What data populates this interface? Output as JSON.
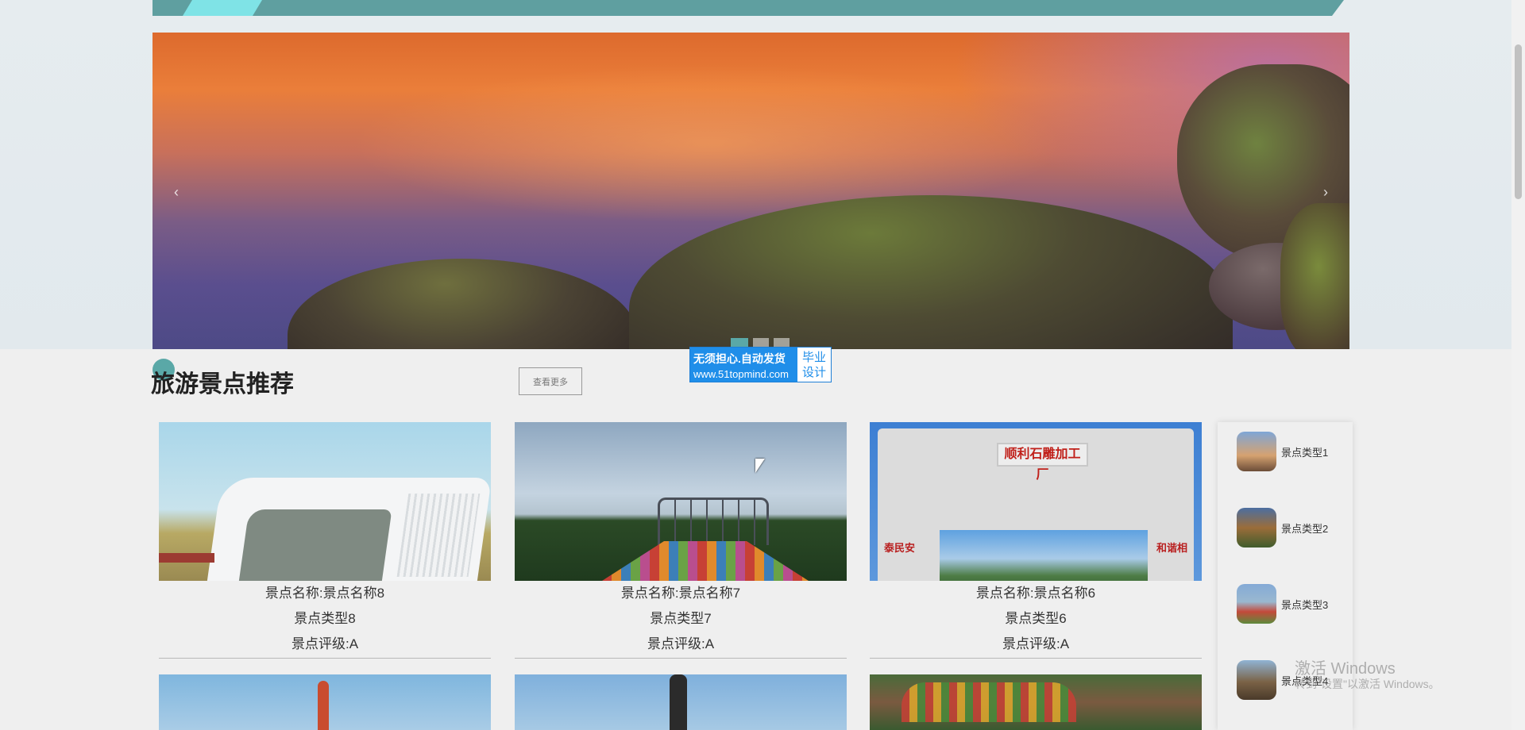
{
  "banner": {
    "prev_glyph": "‹",
    "next_glyph": "›",
    "slide_count": 3,
    "active_slide": 1
  },
  "badge": {
    "line1": "无须担心.自动发货",
    "line2": "www.51topmind.com",
    "right_line1": "毕业",
    "right_line2": "设计"
  },
  "section": {
    "title": "旅游景点推荐",
    "more_label": "查看更多"
  },
  "cards": [
    {
      "name": "景点名称:景点名称8",
      "type": "景点类型8",
      "rating": "景点评级:A"
    },
    {
      "name": "景点名称:景点名称7",
      "type": "景点类型7",
      "rating": "景点评级:A"
    },
    {
      "name": "景点名称:景点名称6",
      "type": "景点类型6",
      "rating": "景点评级:A"
    }
  ],
  "gate_sign": "顺利石雕加工厂",
  "gate_left": "泰民安",
  "gate_right": "和谐相",
  "sidebar": {
    "items": [
      {
        "label": "景点类型1"
      },
      {
        "label": "景点类型2"
      },
      {
        "label": "景点类型3"
      },
      {
        "label": "景点类型4"
      }
    ]
  },
  "activation": {
    "line1": "激活 Windows",
    "line2": "转到\"设置\"以激活 Windows。"
  },
  "colors": {
    "accent": "#5aa8a7",
    "stripe": "#5f9fa0",
    "stripe_light": "#7fe3e6",
    "badge_blue": "#1f8ee9"
  }
}
